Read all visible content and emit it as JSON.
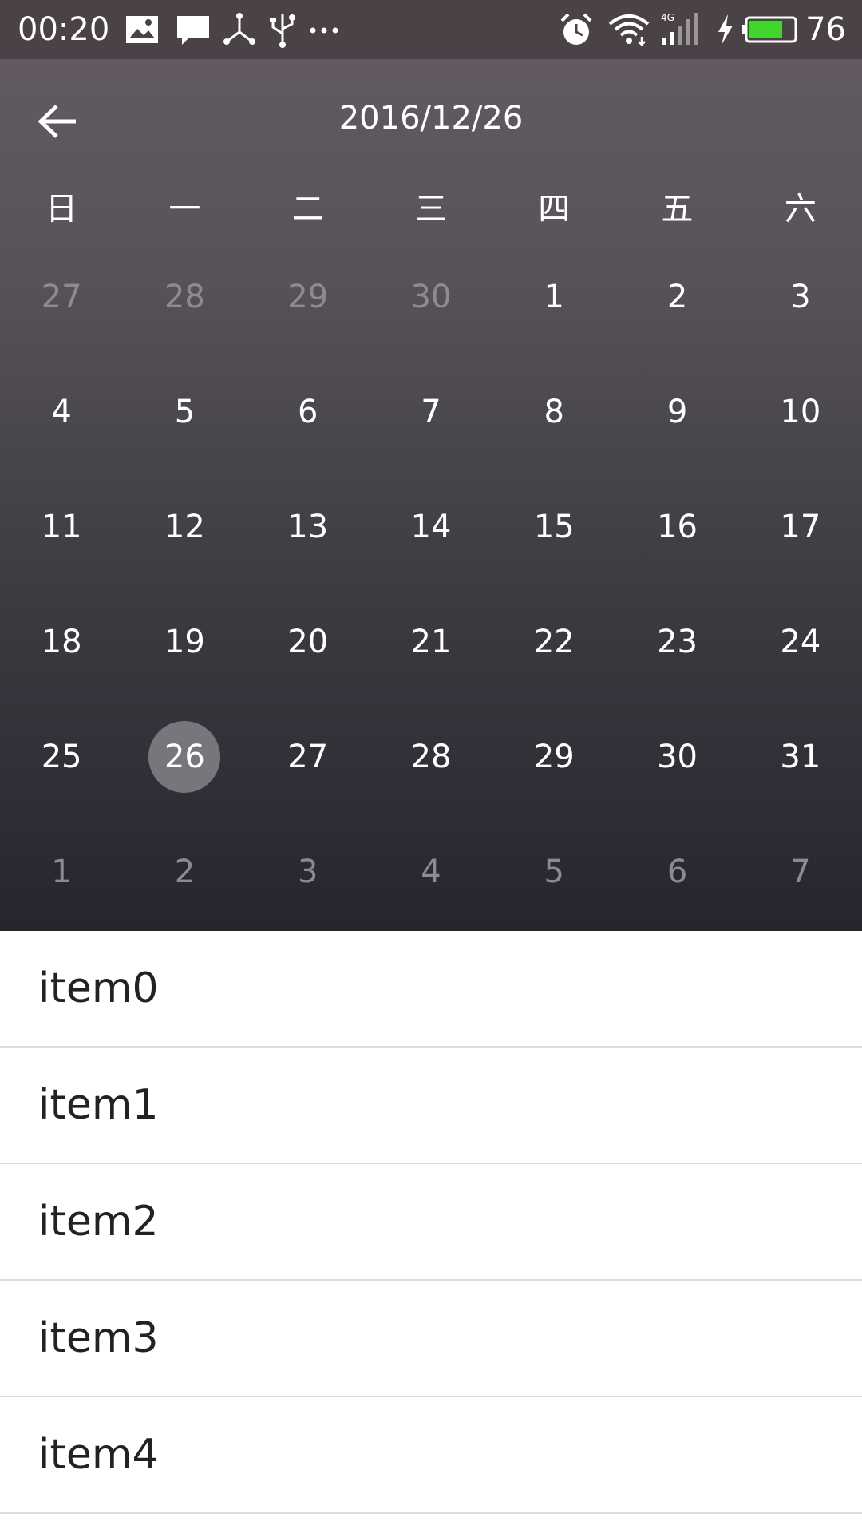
{
  "status_bar": {
    "time": "00:20",
    "battery_percent": "76",
    "battery_level": 0.76,
    "network": "4G",
    "left_icons": [
      "image-icon",
      "message-icon",
      "share-icon",
      "usb-icon",
      "more-icon"
    ],
    "right_icons": [
      "alarm-icon",
      "wifi-icon",
      "signal-icon",
      "charging-icon",
      "battery-icon"
    ]
  },
  "app_bar": {
    "title": "2016/12/26",
    "back_icon": "arrow-left-icon"
  },
  "calendar": {
    "weekdays": [
      "日",
      "一",
      "二",
      "三",
      "四",
      "五",
      "六"
    ],
    "weeks": [
      [
        {
          "d": "27",
          "muted": true
        },
        {
          "d": "28",
          "muted": true
        },
        {
          "d": "29",
          "muted": true
        },
        {
          "d": "30",
          "muted": true
        },
        {
          "d": "1"
        },
        {
          "d": "2"
        },
        {
          "d": "3"
        }
      ],
      [
        {
          "d": "4"
        },
        {
          "d": "5"
        },
        {
          "d": "6"
        },
        {
          "d": "7"
        },
        {
          "d": "8"
        },
        {
          "d": "9"
        },
        {
          "d": "10"
        }
      ],
      [
        {
          "d": "11"
        },
        {
          "d": "12"
        },
        {
          "d": "13"
        },
        {
          "d": "14"
        },
        {
          "d": "15"
        },
        {
          "d": "16"
        },
        {
          "d": "17"
        }
      ],
      [
        {
          "d": "18"
        },
        {
          "d": "19"
        },
        {
          "d": "20"
        },
        {
          "d": "21"
        },
        {
          "d": "22"
        },
        {
          "d": "23"
        },
        {
          "d": "24"
        }
      ],
      [
        {
          "d": "25"
        },
        {
          "d": "26",
          "selected": true
        },
        {
          "d": "27"
        },
        {
          "d": "28"
        },
        {
          "d": "29"
        },
        {
          "d": "30"
        },
        {
          "d": "31"
        }
      ],
      [
        {
          "d": "1",
          "muted": true
        },
        {
          "d": "2",
          "muted": true
        },
        {
          "d": "3",
          "muted": true
        },
        {
          "d": "4",
          "muted": true
        },
        {
          "d": "5",
          "muted": true
        },
        {
          "d": "6",
          "muted": true
        },
        {
          "d": "7",
          "muted": true
        }
      ]
    ],
    "colors": {
      "selected_bg": "#76777d",
      "muted_text": "#8d8a91",
      "text": "#ffffff"
    }
  },
  "list": {
    "items": [
      "item0",
      "item1",
      "item2",
      "item3",
      "item4"
    ]
  }
}
